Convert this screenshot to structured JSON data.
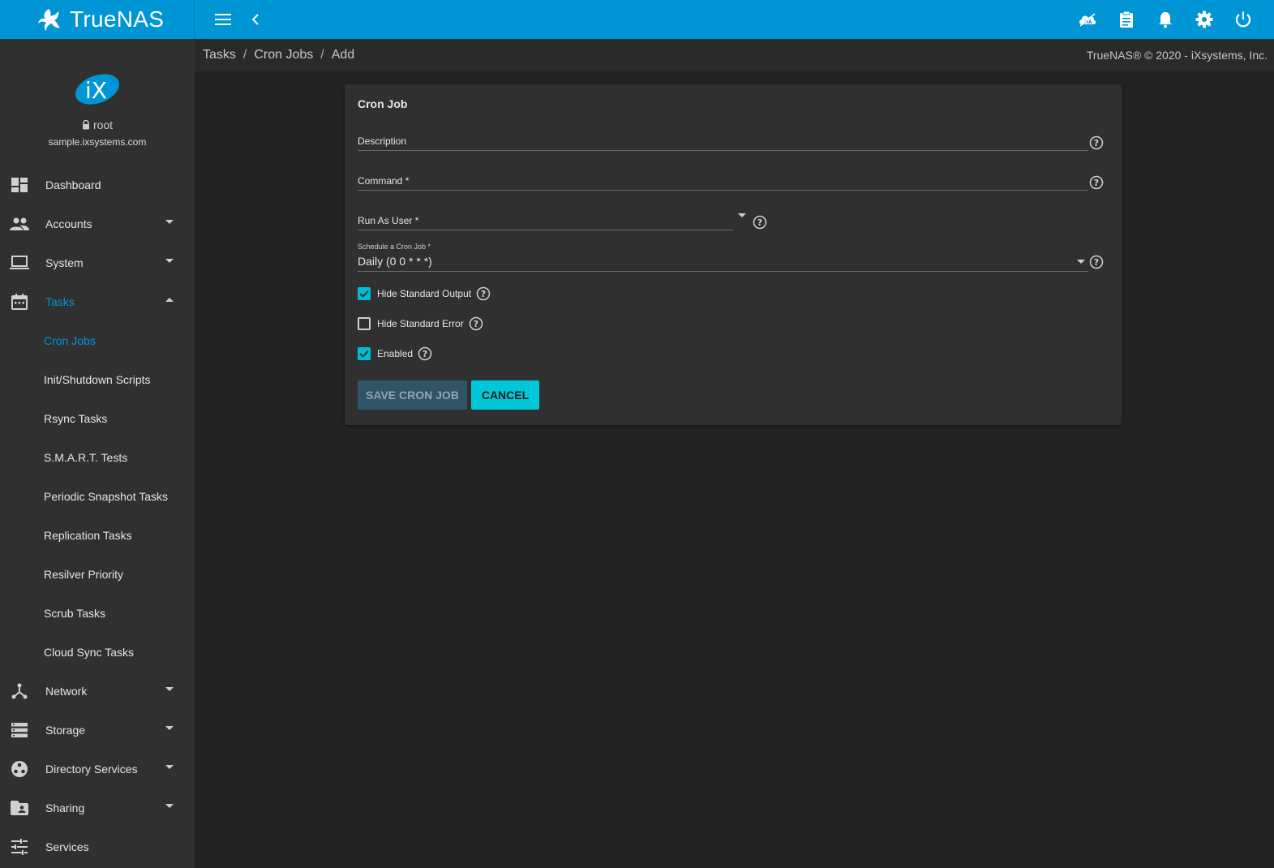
{
  "colors": {
    "accent": "#0095d5",
    "topbar": "#0095d5",
    "checkbox": "#00bcd4",
    "cancel_button": "#00c8d9"
  },
  "topbar": {
    "brand": "TrueNAS",
    "menu_icon": "menu-icon",
    "back_icon": "chevron-left-icon",
    "right_icons": [
      "ha-cloud-icon",
      "clipboard-icon",
      "bell-icon",
      "gear-icon",
      "power-icon"
    ]
  },
  "sidebar": {
    "username": "root",
    "hostname": "sample.ixsystems.com",
    "items": [
      {
        "label": "Dashboard",
        "icon": "dashboard-icon"
      },
      {
        "label": "Accounts",
        "icon": "people-icon"
      },
      {
        "label": "System",
        "icon": "laptop-icon"
      },
      {
        "label": "Tasks",
        "icon": "calendar-icon"
      },
      {
        "label": "Network",
        "icon": "network-icon"
      },
      {
        "label": "Storage",
        "icon": "storage-icon"
      },
      {
        "label": "Directory Services",
        "icon": "directory-icon"
      },
      {
        "label": "Sharing",
        "icon": "folder-shared-icon"
      },
      {
        "label": "Services",
        "icon": "tune-icon"
      }
    ],
    "tasks_subitems": [
      "Cron Jobs",
      "Init/Shutdown Scripts",
      "Rsync Tasks",
      "S.M.A.R.T. Tests",
      "Periodic Snapshot Tasks",
      "Replication Tasks",
      "Resilver Priority",
      "Scrub Tasks",
      "Cloud Sync Tasks"
    ]
  },
  "breadcrumb": [
    "Tasks",
    "Cron Jobs",
    "Add"
  ],
  "copyright": "TrueNAS® © 2020 - iXsystems, Inc.",
  "form": {
    "title": "Cron Job",
    "description_label": "Description",
    "command_label": "Command *",
    "run_as_user_label": "Run As User *",
    "schedule_label": "Schedule a Cron Job *",
    "schedule_value": "Daily (0 0 * * *)",
    "hide_stdout_label": "Hide Standard Output",
    "hide_stdout_checked": true,
    "hide_stderr_label": "Hide Standard Error",
    "hide_stderr_checked": false,
    "enabled_label": "Enabled",
    "enabled_checked": true,
    "save_label": "SAVE CRON JOB",
    "cancel_label": "CANCEL"
  }
}
